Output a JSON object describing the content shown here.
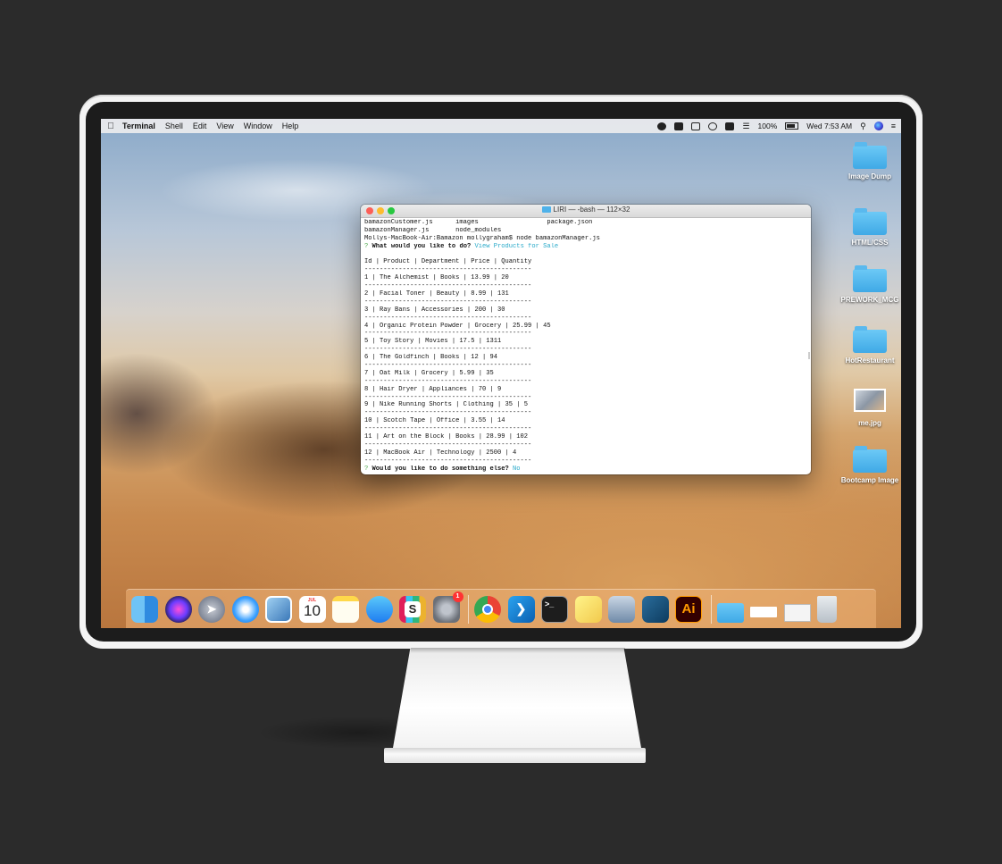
{
  "menubar": {
    "app_name": "Terminal",
    "items": [
      "Shell",
      "Edit",
      "View",
      "Window",
      "Help"
    ],
    "battery": "100%",
    "clock": "Wed 7:53 AM"
  },
  "desktop_icons": [
    {
      "label": "Image Dump",
      "kind": "folder"
    },
    {
      "label": "HTML/CSS",
      "kind": "folder"
    },
    {
      "label": "PREWORK_MCG",
      "kind": "folder"
    },
    {
      "label": "HotRestaurant",
      "kind": "folder"
    },
    {
      "label": "me.jpg",
      "kind": "image"
    },
    {
      "label": "Bootcamp Image",
      "kind": "folder"
    }
  ],
  "terminal": {
    "title": "LIRI — -bash — 112×32",
    "lines": {
      "l1": "bamazonCustomer.js      images                  package.json",
      "l2": "bamazonManager.js       node_modules",
      "l3": "Mollys-MacBook-Air:Bamazon mollygraham$ node bamazonManager.js",
      "q1_mark": "?",
      "q1_text": "What would you like to do?",
      "q1_answer": "View Products for Sale",
      "header": "Id | Product | Department | Price | Quantity",
      "divider": "--------------------------------------------",
      "r1": "1 | The Alchemist | Books | 13.99 | 20",
      "r2": "2 | Facial Toner | Beauty | 8.99 | 131",
      "r3": "3 | Ray Bans | Accessories | 200 | 30",
      "r4": "4 | Organic Protein Powder | Grocery | 25.99 | 45",
      "r5": "5 | Toy Story | Movies | 17.5 | 1311",
      "r6": "6 | The Goldfinch | Books | 12 | 94",
      "r7": "7 | Oat Milk | Grocery | 5.99 | 35",
      "r8": "8 | Hair Dryer | Appliances | 70 | 9",
      "r9": "9 | Nike Running Shorts | Clothing | 35 | 5",
      "r10": "10 | Scotch Tape | Office | 3.55 | 14",
      "r11": "11 | Art on the Block | Books | 28.99 | 102",
      "r12": "12 | MacBook Air | Technology | 2500 | 4",
      "q2_mark": "?",
      "q2_text": "Would you like to do something else?",
      "q2_answer": "No"
    }
  },
  "dock": {
    "apps": [
      "finder-icon",
      "siri-icon",
      "launchpad-icon",
      "safari-icon",
      "preview-icon",
      "calendar-icon",
      "notes-icon",
      "messages-icon",
      "slack-icon",
      "system-preferences-icon",
      "chrome-icon",
      "vscode-icon",
      "terminal-icon",
      "stickies-icon",
      "image-capture-icon",
      "mysql-workbench-icon",
      "illustrator-icon",
      "downloads-folder-icon",
      "recent-files-icon",
      "documents-stack-icon",
      "trash-icon"
    ],
    "calendar_month": "JUL",
    "calendar_day": "10",
    "sysprefs_badge": "1",
    "illustrator_label": "Ai",
    "slack_label": "S"
  },
  "colors": {
    "folder_blue": "#4fb2ea",
    "terminal_cyan": "#28a9c9",
    "frame_background": "#2b2b2b"
  }
}
